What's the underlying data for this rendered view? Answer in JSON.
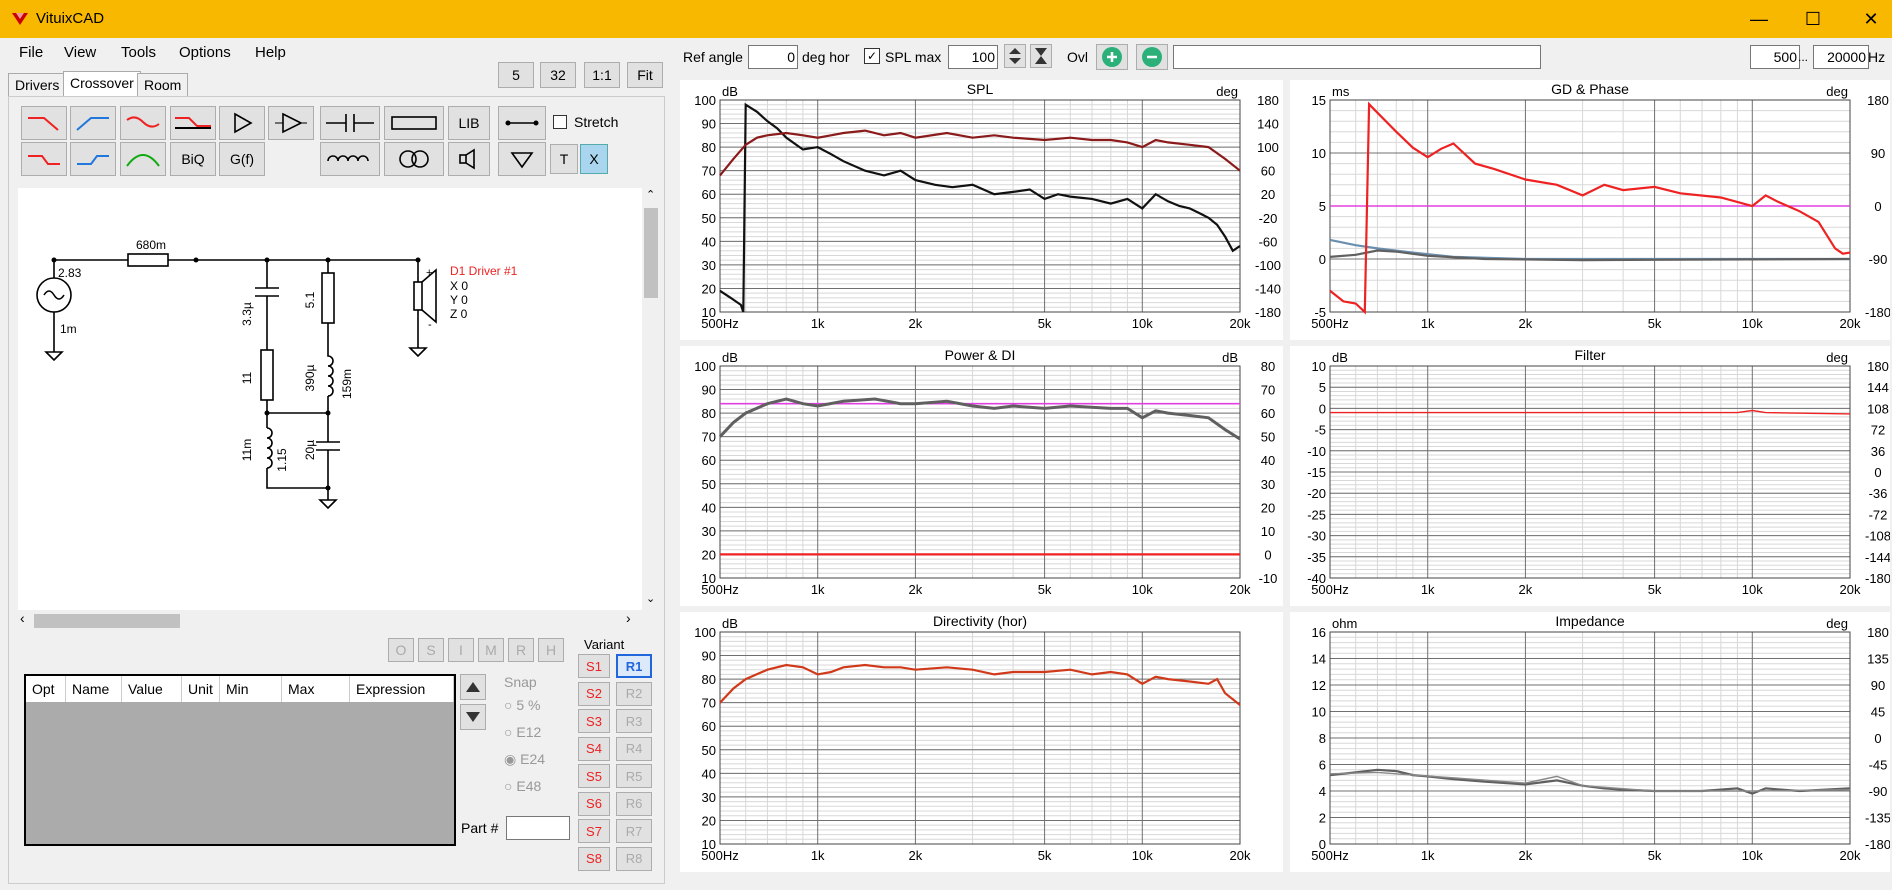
{
  "window": {
    "title": "VituixCAD"
  },
  "menu": [
    "File",
    "View",
    "Tools",
    "Options",
    "Help"
  ],
  "tabs": [
    "Drivers",
    "Crossover",
    "Room"
  ],
  "view_buttons": [
    "5",
    "32",
    "1:1",
    "Fit"
  ],
  "toolbar": {
    "lib": "LIB",
    "biq": "BiQ",
    "gf": "G(f)",
    "stretch": "Stretch",
    "t": "T",
    "x": "X"
  },
  "top_controls": {
    "ref_angle_label": "Ref angle",
    "ref_angle_value": "0",
    "deg_hor": "deg hor",
    "spl_max_label": "SPL max",
    "spl_max_value": "100",
    "ovl": "Ovl",
    "freq_min": "500",
    "ellipsis": "...",
    "freq_max": "20000",
    "hz": "Hz"
  },
  "schematic": {
    "r1": "680m",
    "source_v": "2.83",
    "source_r": "1m",
    "c1": "3.3µ",
    "r2": "11",
    "l1": "11m",
    "l1r": "1.15",
    "r3": "5.1",
    "l2": "390µ",
    "l2r": "159m",
    "c2": "20µ",
    "driver": "D1 Driver #1",
    "x": "X 0",
    "y": "Y 0",
    "z": "Z 0",
    "plus": "+",
    "minus": "-"
  },
  "opt_buttons": [
    "O",
    "S",
    "I",
    "M",
    "R",
    "H"
  ],
  "table_headers": [
    "Opt",
    "Name",
    "Value",
    "Unit",
    "Min",
    "Max",
    "Expression"
  ],
  "snap": {
    "label": "Snap",
    "options": [
      "5 %",
      "E12",
      "E24",
      "E48"
    ]
  },
  "part_label": "Part #",
  "variant": {
    "label": "Variant",
    "s": [
      "S1",
      "S2",
      "S3",
      "S4",
      "S5",
      "S6",
      "S7",
      "S8"
    ],
    "r": [
      "R1",
      "R2",
      "R3",
      "R4",
      "R5",
      "R6",
      "R7",
      "R8"
    ]
  },
  "charts": {
    "xticks": [
      "500Hz",
      "1k",
      "2k",
      "5k",
      "10k",
      "20k"
    ],
    "spl": {
      "title": "SPL",
      "left_unit": "dB",
      "right_unit": "deg",
      "left": [
        "100",
        "90",
        "80",
        "70",
        "60",
        "50",
        "40",
        "30",
        "20",
        "10"
      ],
      "right": [
        "180",
        "140",
        "100",
        "60",
        "20",
        "-20",
        "-60",
        "-100",
        "-140",
        "-180"
      ]
    },
    "gd": {
      "title": "GD & Phase",
      "left_unit": "ms",
      "right_unit": "deg",
      "left": [
        "15",
        "10",
        "5",
        "0",
        "-5"
      ],
      "right": [
        "180",
        "90",
        "0",
        "-90",
        "-180"
      ]
    },
    "power": {
      "title": "Power & DI",
      "left_unit": "dB",
      "right_unit": "dB",
      "left": [
        "100",
        "90",
        "80",
        "70",
        "60",
        "50",
        "40",
        "30",
        "20",
        "10"
      ],
      "right": [
        "80",
        "70",
        "60",
        "50",
        "40",
        "30",
        "20",
        "10",
        "0",
        "-10"
      ]
    },
    "filter": {
      "title": "Filter",
      "left_unit": "dB",
      "right_unit": "deg",
      "left": [
        "10",
        "5",
        "0",
        "-5",
        "-10",
        "-15",
        "-20",
        "-25",
        "-30",
        "-35",
        "-40"
      ],
      "right": [
        "180",
        "144",
        "108",
        "72",
        "36",
        "0",
        "-36",
        "-72",
        "-108",
        "-144",
        "-180"
      ]
    },
    "directivity": {
      "title": "Directivity (hor)",
      "left_unit": "dB",
      "left": [
        "100",
        "90",
        "80",
        "70",
        "60",
        "50",
        "40",
        "30",
        "20",
        "10"
      ]
    },
    "impedance": {
      "title": "Impedance",
      "left_unit": "ohm",
      "right_unit": "deg",
      "left": [
        "16",
        "14",
        "12",
        "10",
        "8",
        "6",
        "4",
        "2",
        "0"
      ],
      "right": [
        "180",
        "135",
        "90",
        "45",
        "0",
        "-45",
        "-90",
        "-135",
        "-180"
      ]
    }
  },
  "colors": {
    "title_bar": "#f8b800",
    "curve_red": "#ee2222",
    "curve_dark": "#111111",
    "curve_darkred": "#8b1a1a",
    "curve_gray": "#606060",
    "curve_pink": "#e040e0",
    "curve_blue": "#6a8faf"
  }
}
